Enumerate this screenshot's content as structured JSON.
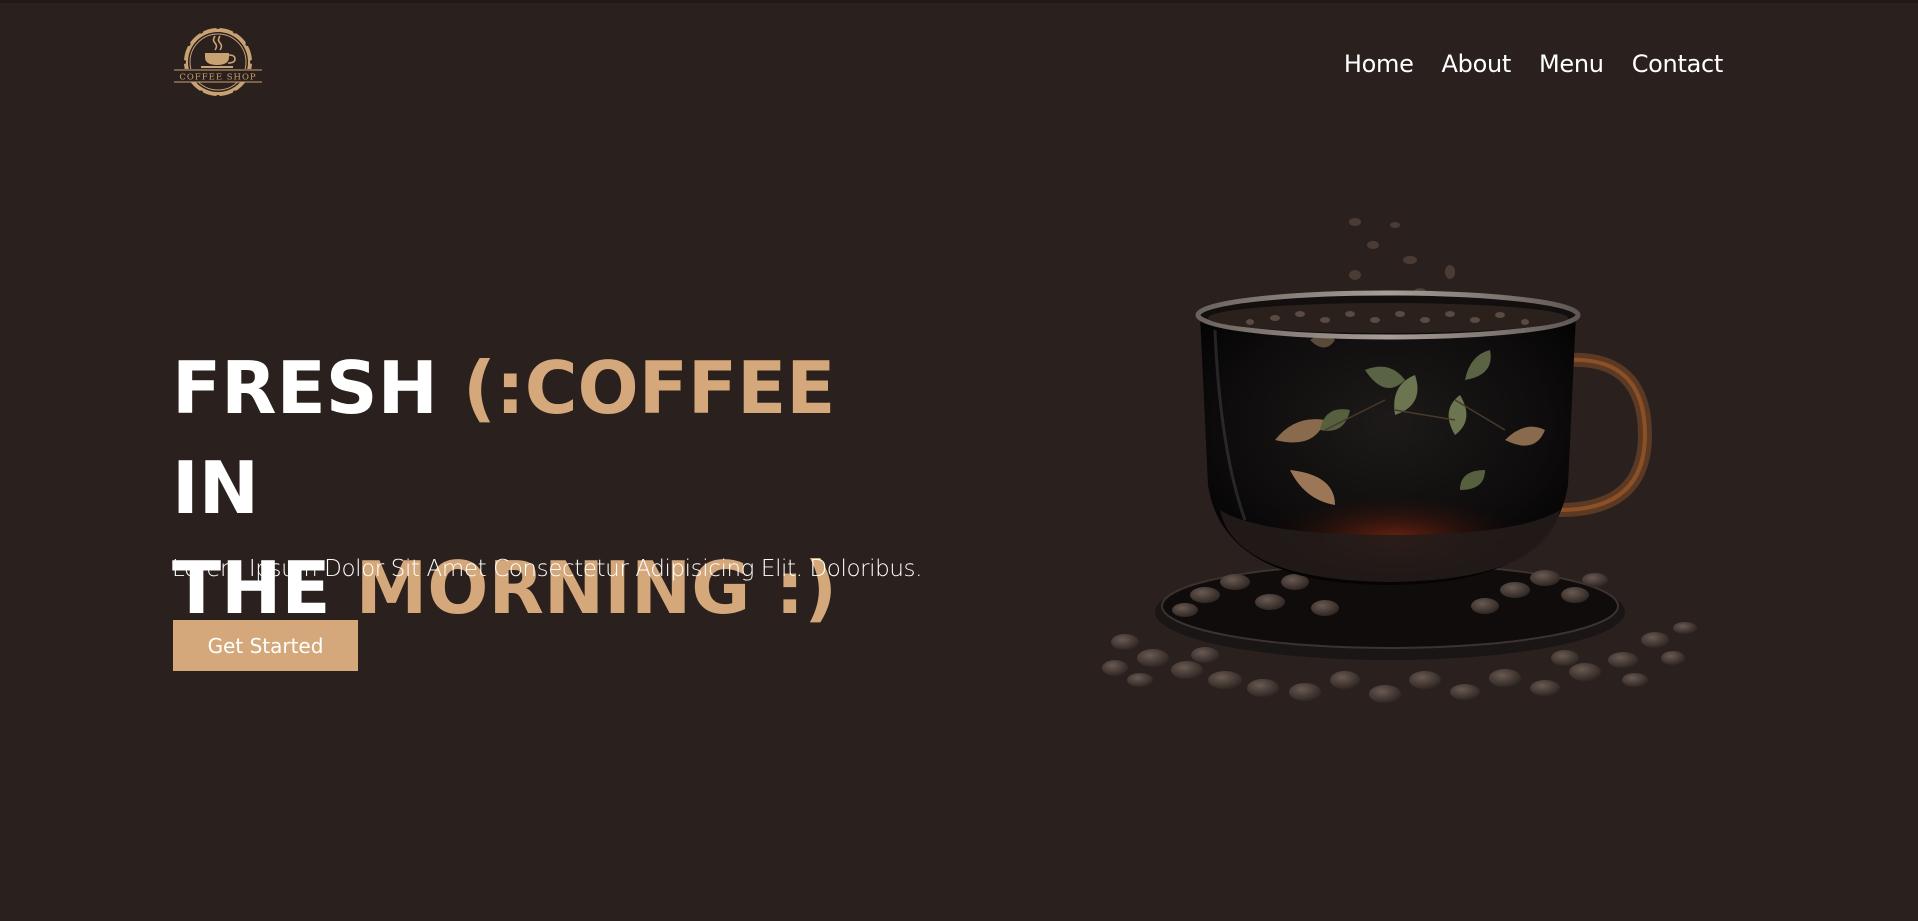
{
  "logo": {
    "text": "COFFEE SHOP",
    "icon": "coffee-cup-badge-icon"
  },
  "nav": {
    "items": [
      {
        "label": "Home"
      },
      {
        "label": "About"
      },
      {
        "label": "Menu"
      },
      {
        "label": "Contact"
      }
    ]
  },
  "hero": {
    "title_part1": "FRESH ",
    "title_accent1": "(:COFFEE",
    "title_part2": " IN",
    "title_part3": "THE ",
    "title_accent2": "MORNING :)",
    "subtitle": "Lorem Ipsum Dolor Sit Amet Consectetur Adipisicing Elit. Doloribus.",
    "cta_label": "Get Started",
    "image": "coffee-cup-with-beans-image"
  },
  "colors": {
    "background": "#2a201d",
    "accent": "#d4a87a",
    "text": "#ffffff"
  }
}
